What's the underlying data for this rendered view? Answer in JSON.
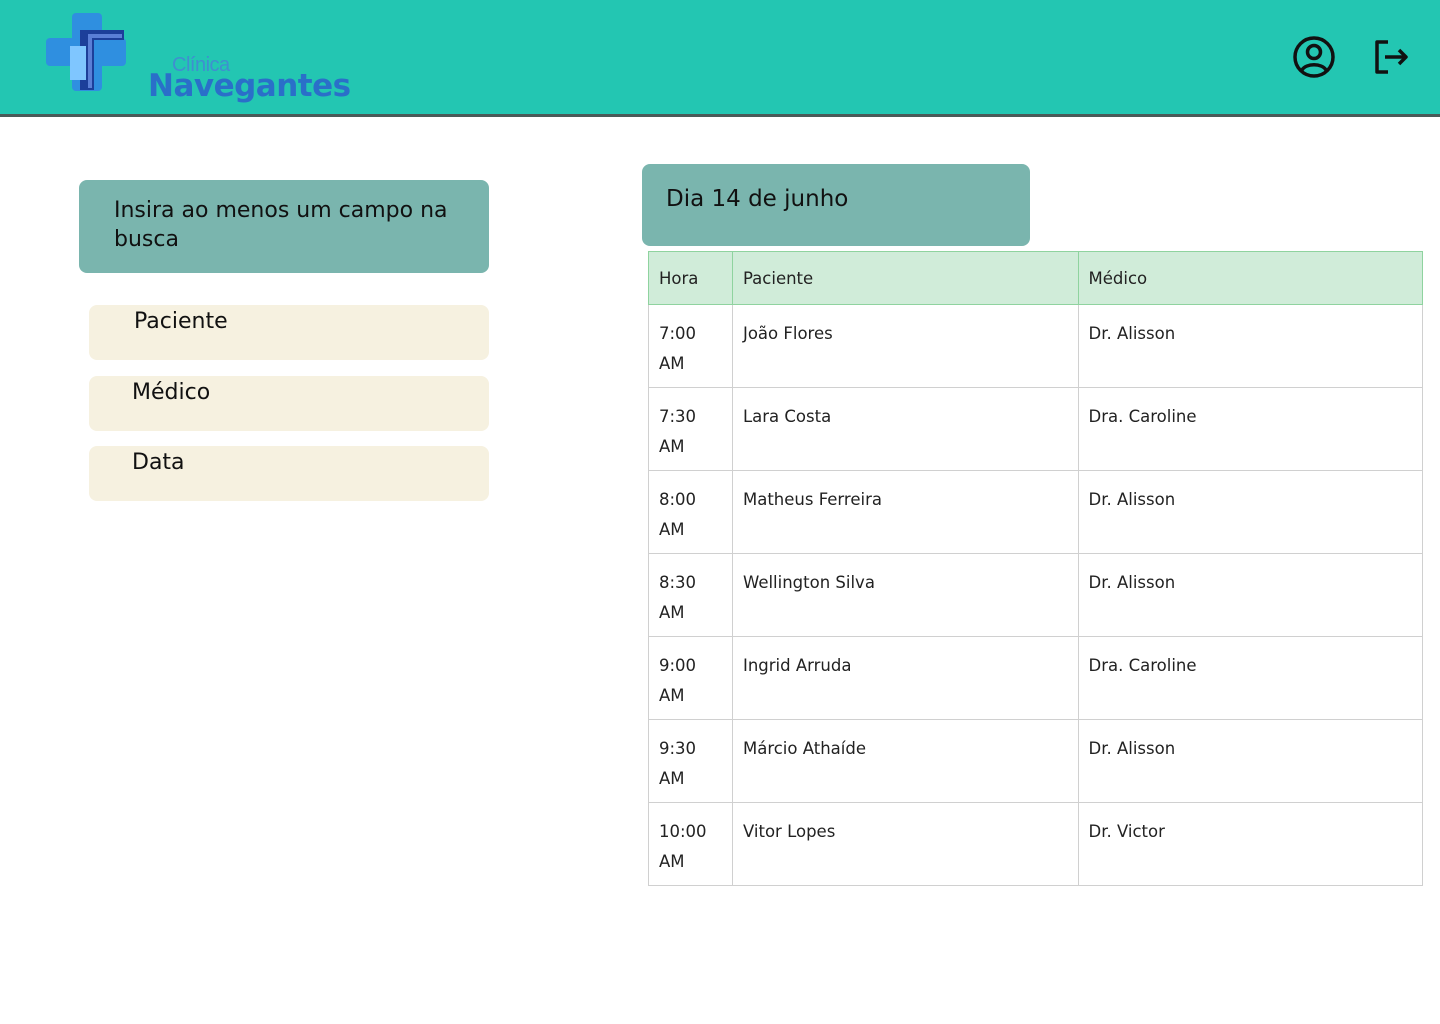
{
  "header": {
    "logo": {
      "line1": "Clínica",
      "line2": "Navegantes"
    },
    "icons": [
      "user-circle-icon",
      "logout-icon"
    ],
    "background": "#23c6b2"
  },
  "search": {
    "hint": "Insira ao menos um campo na busca",
    "fields": {
      "paciente": "Paciente",
      "medico": "Médico",
      "data": "Data"
    }
  },
  "schedule": {
    "date_label": "Dia 14 de junho",
    "headers": {
      "hora": "Hora",
      "paciente": "Paciente",
      "medico": "Médico"
    },
    "rows": [
      {
        "time": "7:00",
        "ampm": "AM",
        "paciente": "João Flores",
        "medico": "Dr. Alisson"
      },
      {
        "time": "7:30",
        "ampm": "AM",
        "paciente": "Lara Costa",
        "medico": "Dra. Caroline"
      },
      {
        "time": "8:00",
        "ampm": "AM",
        "paciente": "Matheus Ferreira",
        "medico": "Dr. Alisson"
      },
      {
        "time": "8:30",
        "ampm": "AM",
        "paciente": "Wellington Silva",
        "medico": "Dr. Alisson"
      },
      {
        "time": "9:00",
        "ampm": "AM",
        "paciente": "Ingrid Arruda",
        "medico": "Dra. Caroline"
      },
      {
        "time": "9:30",
        "ampm": "AM",
        "paciente": "Márcio Athaíde",
        "medico": "Dr. Alisson"
      },
      {
        "time": "10:00",
        "ampm": "AM",
        "paciente": "Vitor Lopes",
        "medico": "Dr. Victor"
      }
    ]
  }
}
